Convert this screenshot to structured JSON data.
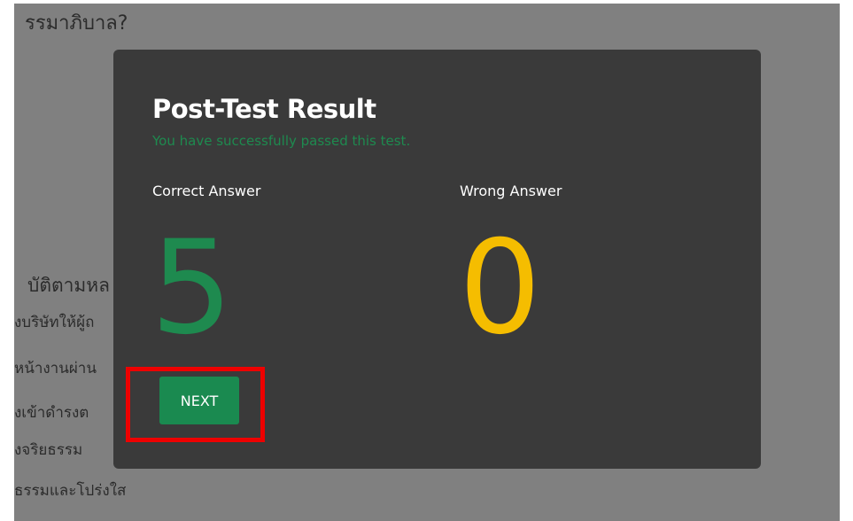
{
  "background": {
    "question_fragment": "รรมาภิบาล?",
    "heading_fragment": "บัติตามหล",
    "lines": [
      "งบริษัทให้ผู้ถ",
      "หน้างานผ่าน",
      "งเข้าดำรงต",
      "งจริยธรรม",
      "ธรรมและโปร่งใส"
    ]
  },
  "modal": {
    "title": "Post-Test Result",
    "subtitle": "You have successfully passed this test.",
    "correct": {
      "label": "Correct Answer",
      "value": "5"
    },
    "wrong": {
      "label": "Wrong Answer",
      "value": "0"
    },
    "next_label": "NEXT"
  },
  "colors": {
    "modal_bg": "#3a3a3a",
    "success_green": "#1e8a4f",
    "warning_yellow": "#f5bd00",
    "highlight_red": "#ee0000",
    "overlay_gray": "#808080"
  }
}
